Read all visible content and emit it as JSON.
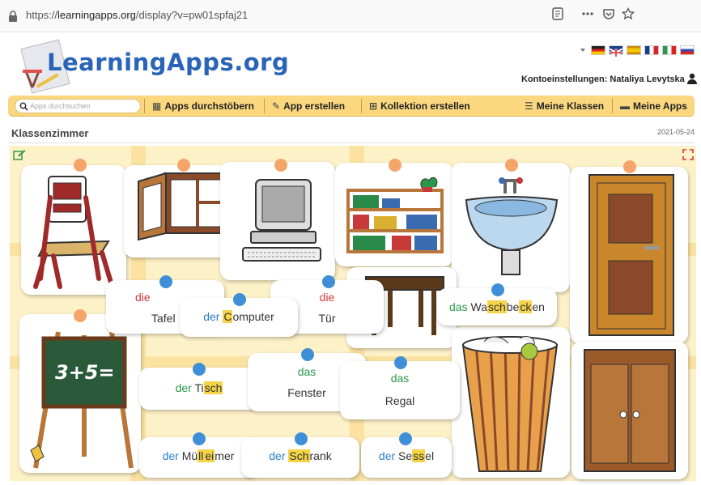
{
  "browser": {
    "url_prefix": "https://",
    "url_host": "learningapps.org",
    "url_path": "/display?v=pw01spfaj21"
  },
  "brand": {
    "logo_text": "LearningApps.org"
  },
  "account": {
    "label": "Kontoeinstellungen: Nataliya Levytska"
  },
  "nav": {
    "search_placeholder": "Apps durchsuchen",
    "items": [
      {
        "label": "Apps durchstöbern",
        "icon": "grid-icon"
      },
      {
        "label": "App erstellen",
        "icon": "pencil-icon"
      },
      {
        "label": "Kollektion erstellen",
        "icon": "collection-icon"
      },
      {
        "label": "Meine Klassen",
        "icon": "list-icon"
      },
      {
        "label": "Meine Apps",
        "icon": "folder-icon"
      }
    ]
  },
  "page": {
    "title": "Klassenzimmer",
    "date": "2021-05-24"
  },
  "colors": {
    "nav": "#fbd87f",
    "board": "#fdf1c8",
    "logo": "#2a64b8",
    "masculine": "#2a7fd0",
    "feminine": "#d23a3a",
    "neuter": "#2a9a4a"
  },
  "pictures": [
    "chair",
    "window",
    "computer",
    "bookshelf",
    "sink",
    "door",
    "table",
    "blackboard",
    "wastebasket",
    "wardrobe"
  ],
  "words": {
    "tafel": {
      "article": "die",
      "noun": "Tafel"
    },
    "computer": {
      "article": "der",
      "pre": "",
      "hl": "C",
      "post": "omputer"
    },
    "tuer": {
      "article": "die",
      "noun": "Tür"
    },
    "waschbecken": {
      "article": "das",
      "pre": "Wa",
      "hl": "sch",
      "mid": "be",
      "hl2": "ck",
      "post": "en"
    },
    "tisch": {
      "article": "der",
      "pre": "Ti",
      "hl": "sch",
      "post": ""
    },
    "fenster": {
      "article": "das",
      "noun": "Fenster"
    },
    "regal": {
      "article": "das",
      "noun": "Regal"
    },
    "muelleimer": {
      "article": "der",
      "pre": "Mü",
      "hl": "ll",
      "mid": "",
      "hl2": "ei",
      "post": "mer"
    },
    "schrank": {
      "article": "der",
      "pre": "",
      "hl": "Sch",
      "post": "rank"
    },
    "sessel": {
      "article": "der",
      "pre": "Se",
      "hl": "ss",
      "post": "el"
    }
  }
}
